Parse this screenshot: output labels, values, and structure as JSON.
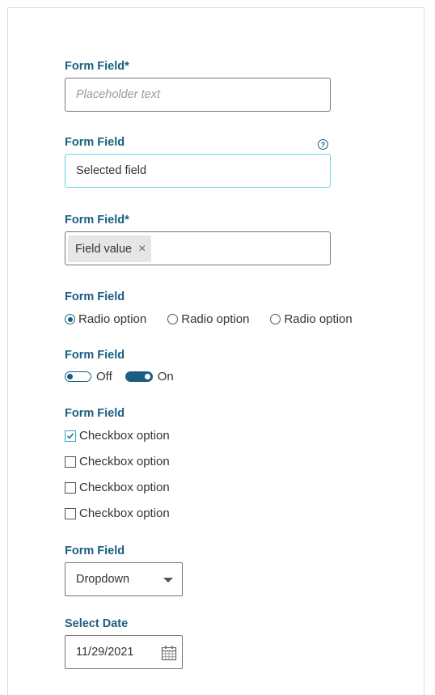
{
  "form": {
    "field1": {
      "label": "Form Field*",
      "placeholder": "Placeholder text"
    },
    "field2": {
      "label": "Form Field",
      "value": "Selected field",
      "help_glyph": "?"
    },
    "field3": {
      "label": "Form Field*",
      "chip": "Field value",
      "chip_remove": "×"
    },
    "radio_group": {
      "label": "Form Field",
      "options": [
        "Radio option",
        "Radio option",
        "Radio option"
      ],
      "selected_index": 0
    },
    "toggle_group": {
      "label": "Form Field",
      "off_label": "Off",
      "on_label": "On"
    },
    "checkbox_group": {
      "label": "Form Field",
      "options": [
        "Checkbox option",
        "Checkbox option",
        "Checkbox option",
        "Checkbox option"
      ],
      "checked": [
        true,
        false,
        false,
        false
      ]
    },
    "dropdown": {
      "label": "Form Field",
      "value": "Dropdown"
    },
    "date": {
      "label": "Select Date",
      "value": "11/29/2021"
    }
  },
  "colors": {
    "label": "#1b5e83",
    "accent": "#1b5e83",
    "focus_border": "#6ad0e3",
    "checkbox_checked": "#2aa8c4"
  },
  "icons": {
    "help": "help-circle-icon",
    "remove": "close-icon",
    "checkmark": "check-icon",
    "dropdown": "caret-down-icon",
    "date": "calendar-icon"
  }
}
